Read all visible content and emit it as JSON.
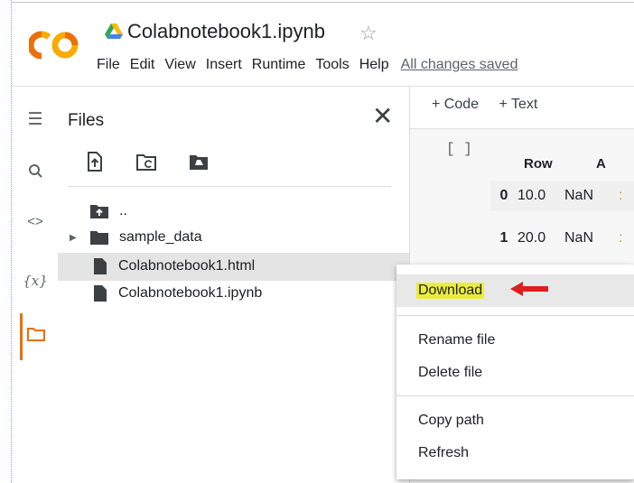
{
  "header": {
    "logo_text": "CO",
    "notebook_title": "Colabnotebook1.ipynb",
    "star_icon": "star-outline-icon",
    "drive_icon": "google-drive-icon",
    "menu": [
      "File",
      "Edit",
      "View",
      "Insert",
      "Runtime",
      "Tools",
      "Help"
    ],
    "save_status": "All changes saved"
  },
  "rail": {
    "icons": [
      "menu-icon",
      "search-icon",
      "code-icon",
      "variables-icon",
      "folder-icon"
    ],
    "variables_label": "{x}",
    "code_label": "<>"
  },
  "files": {
    "title": "Files",
    "toolbar": [
      "upload-file-icon",
      "refresh-folder-icon",
      "mount-drive-icon"
    ],
    "tree": [
      {
        "label": "..",
        "type": "folder-up"
      },
      {
        "label": "sample_data",
        "type": "folder"
      },
      {
        "label": "Colabnotebook1.html",
        "type": "file",
        "selected": true
      },
      {
        "label": "Colabnotebook1.ipynb",
        "type": "file"
      }
    ]
  },
  "notebook": {
    "add_code": "+ Code",
    "add_text": "+ Text",
    "cell_bracket": "[ ]",
    "columns": [
      "Row",
      "A"
    ],
    "rows": [
      {
        "index": "0",
        "row": "10.0",
        "a": "NaN"
      },
      {
        "index": "1",
        "row": "20.0",
        "a": "NaN"
      }
    ]
  },
  "context_menu": {
    "items": [
      {
        "label": "Download",
        "highlighted": true
      },
      {
        "label": "Rename file"
      },
      {
        "label": "Delete file"
      },
      {
        "label": "Copy path"
      },
      {
        "label": "Refresh"
      }
    ],
    "arrow_color": "#e01e1e"
  },
  "colors": {
    "accent_orange": "#e8710a",
    "logo_orange": "#f9ab00",
    "highlight_yellow": "#ecec3c"
  }
}
